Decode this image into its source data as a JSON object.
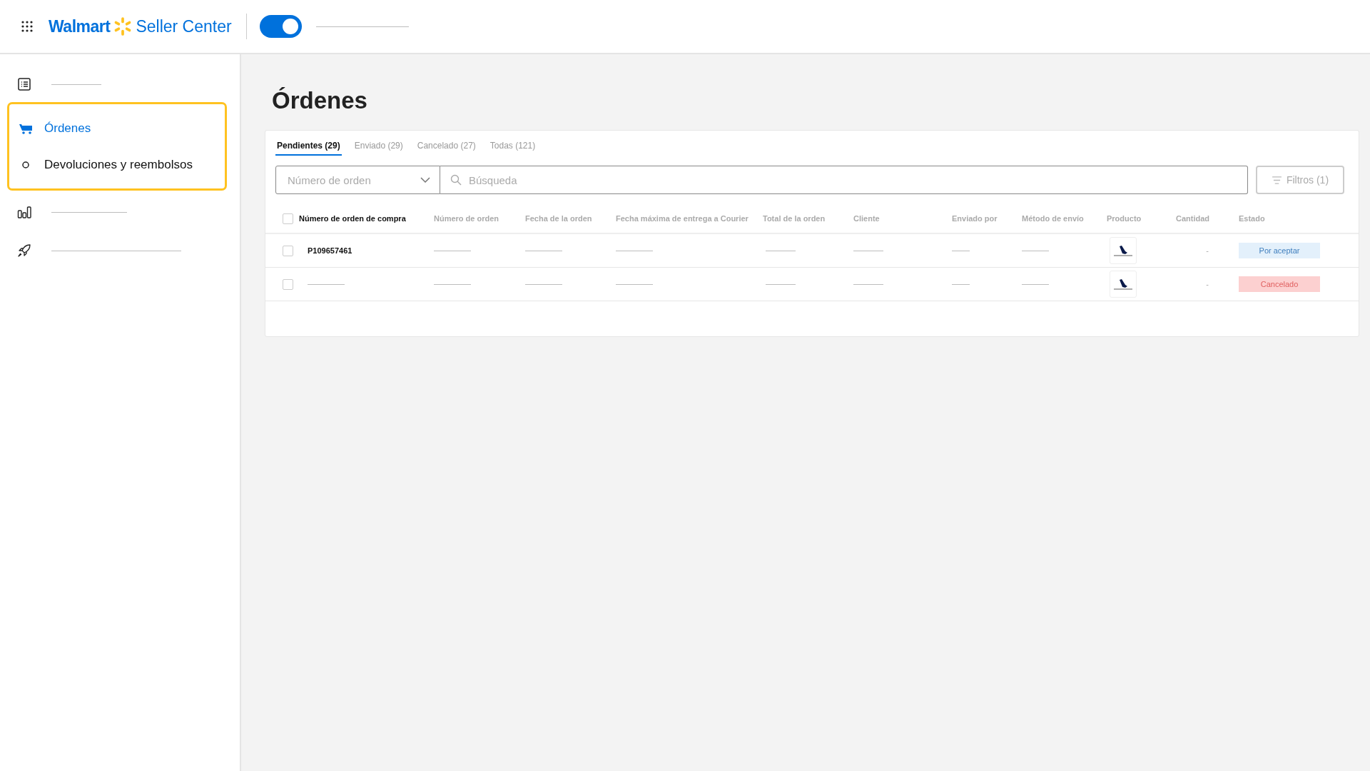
{
  "header": {
    "logo_text": "Walmart",
    "product_name": "Seller Center",
    "toggle": {
      "on": true
    }
  },
  "sidebar": {
    "highlighted_group": [
      {
        "label": "Órdenes",
        "selected": true
      },
      {
        "label": "Devoluciones y reembolsos",
        "selected": false
      }
    ]
  },
  "page_title": "Órdenes",
  "tabs": [
    {
      "label": "Pendientes (29)",
      "selected": true
    },
    {
      "label": "Enviado (29)",
      "selected": false
    },
    {
      "label": "Cancelado (27)",
      "selected": false
    },
    {
      "label": "Todas (121)",
      "selected": false
    }
  ],
  "search_type": {
    "placeholder": "Número de orden"
  },
  "search": {
    "placeholder": "Búsqueda"
  },
  "filters_button": "Filtros (1)",
  "table": {
    "select_all": {
      "checked": false
    },
    "columns": [
      "Número de orden de compra",
      "Número de orden",
      "Fecha de la orden",
      "Fecha máxima de entrega a Courier",
      "Total de la orden",
      "Cliente",
      "Enviado por",
      "Método de envío",
      "Producto",
      "Cantidad",
      "Estado"
    ],
    "rows": [
      {
        "checked": false,
        "purchase_order": "P109657461",
        "quantity": "-",
        "status": {
          "label": "Por aceptar",
          "kind": "pending"
        }
      },
      {
        "checked": false,
        "quantity": "-",
        "status": {
          "label": "Cancelado",
          "kind": "cancelled"
        }
      }
    ]
  }
}
